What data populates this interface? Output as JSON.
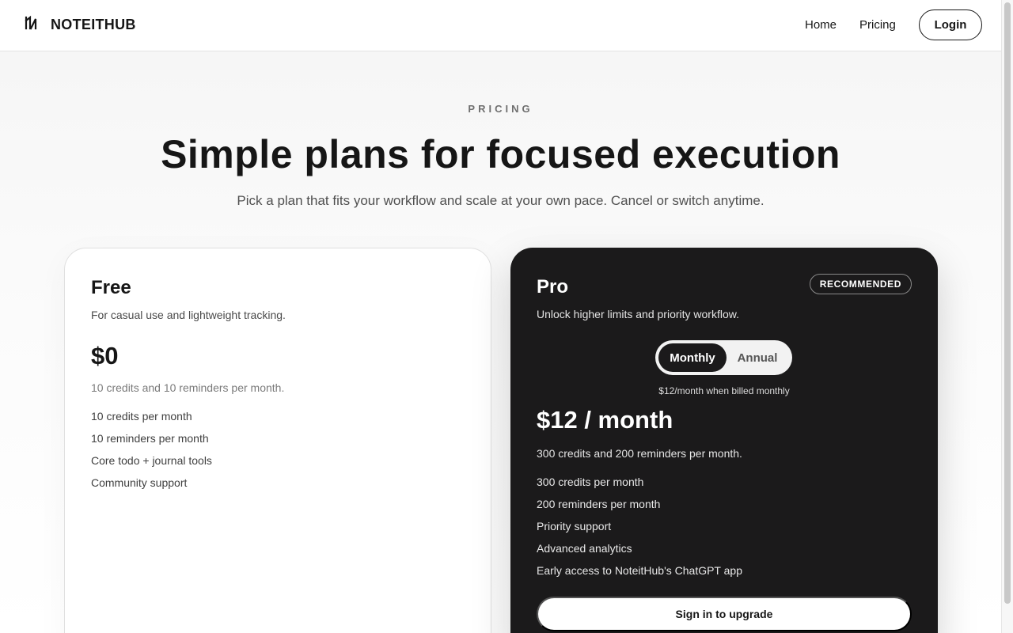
{
  "header": {
    "brand": "NOTEITHUB",
    "nav": {
      "home": "Home",
      "pricing": "Pricing"
    },
    "login_label": "Login"
  },
  "hero": {
    "eyebrow": "PRICING",
    "title": "Simple plans for focused execution",
    "subtitle": "Pick a plan that fits your workflow and scale at your own pace. Cancel or switch anytime."
  },
  "plans": {
    "free": {
      "name": "Free",
      "description": "For casual use and lightweight tracking.",
      "price": "$0",
      "summary": "10 credits and 10 reminders per month.",
      "features": [
        "10 credits per month",
        "10 reminders per month",
        "Core todo + journal tools",
        "Community support"
      ]
    },
    "pro": {
      "name": "Pro",
      "badge": "RECOMMENDED",
      "description": "Unlock higher limits and priority workflow.",
      "billing_toggle": {
        "monthly": "Monthly",
        "annual": "Annual",
        "selected": "Monthly"
      },
      "billing_note": "$12/month when billed monthly",
      "price": "$12 / month",
      "summary": "300 credits and 200 reminders per month.",
      "features": [
        "300 credits per month",
        "200 reminders per month",
        "Priority support",
        "Advanced analytics",
        "Early access to NoteitHub's ChatGPT app"
      ],
      "cta_label": "Sign in to upgrade"
    }
  },
  "colors": {
    "text_primary": "#161616",
    "pro_card_bg": "#1b1a1b",
    "page_bg": "#f5f5f5"
  },
  "icons": {
    "logo": "noteithub-logo-icon"
  }
}
